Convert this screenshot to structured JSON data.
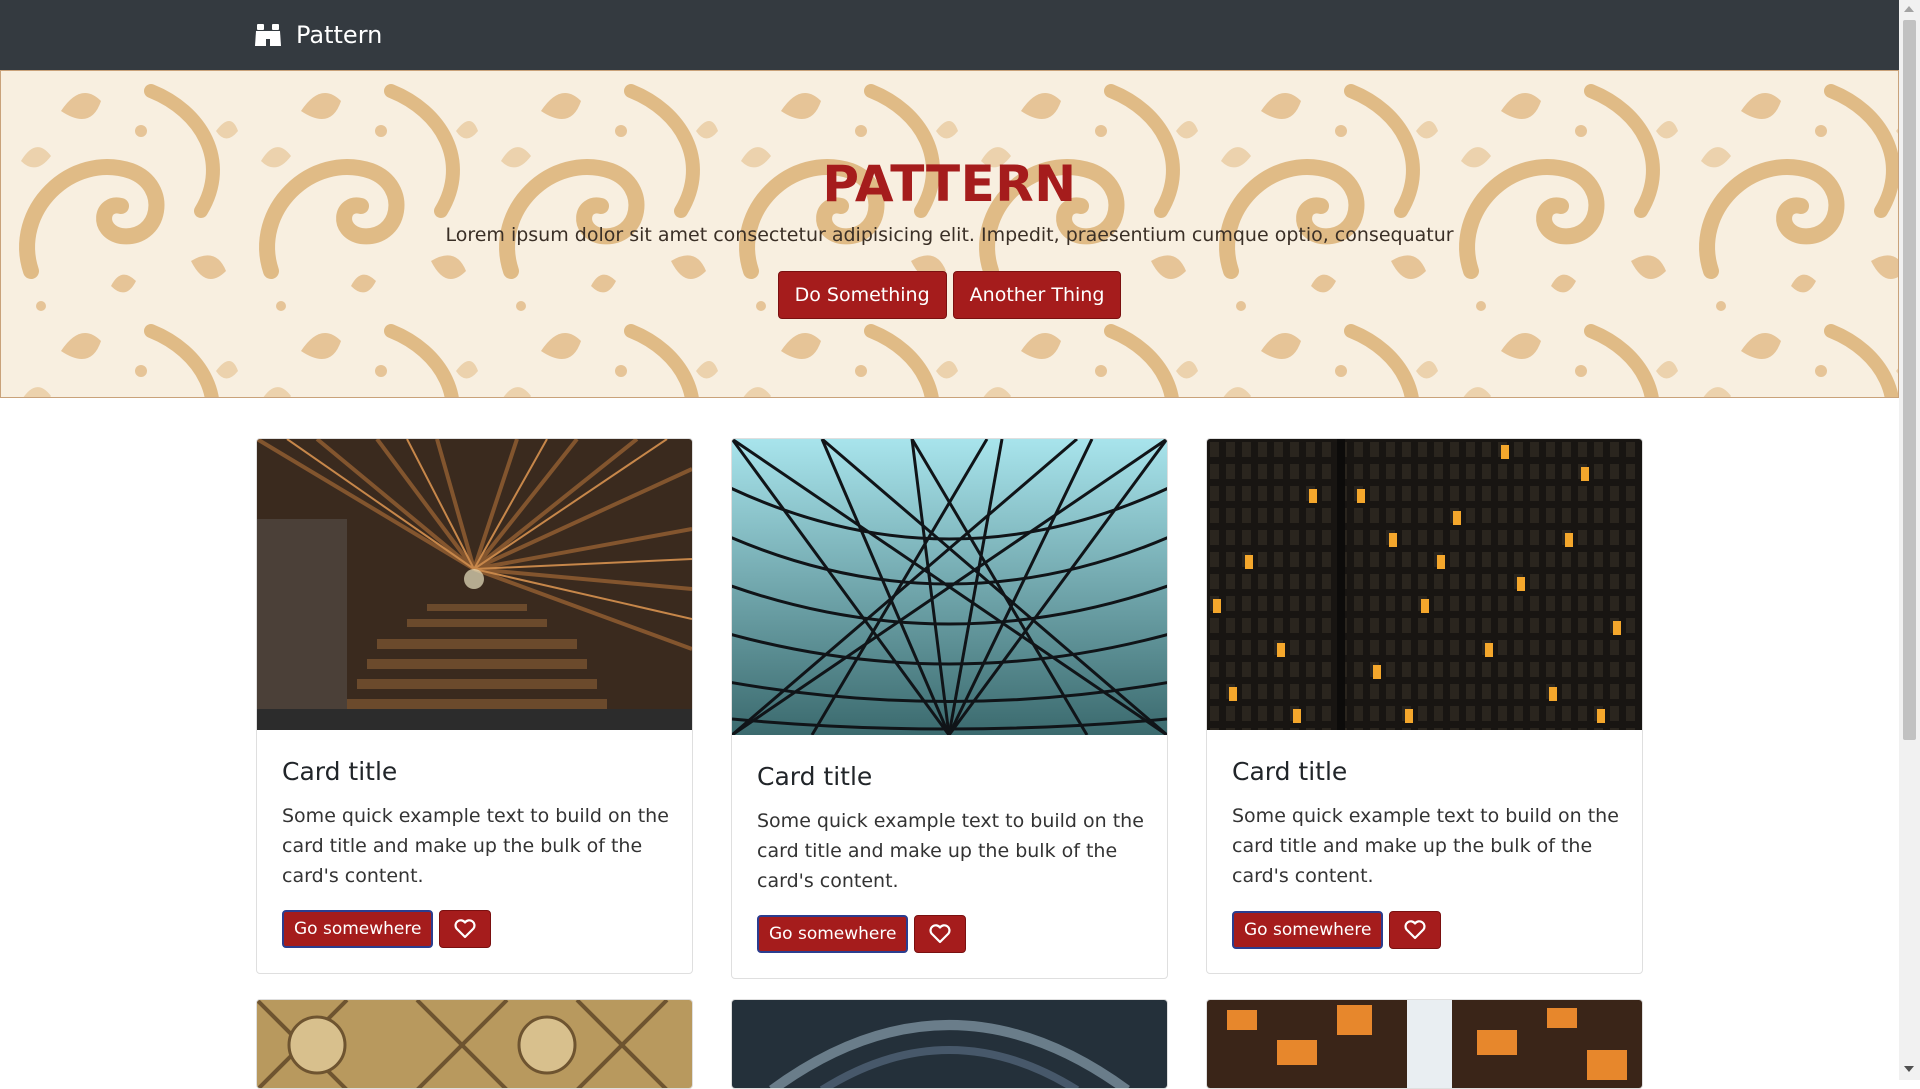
{
  "navbar": {
    "brand": "Pattern",
    "brand_icon": "binoculars-icon"
  },
  "hero": {
    "title": "PATTERN",
    "subtitle": "Lorem ipsum dolor sit amet consectetur adipisicing elit. Impedit, praesentium cumque optio, consequatur",
    "primary_button": "Do Something",
    "secondary_button": "Another Thing"
  },
  "cards": [
    {
      "title": "Card title",
      "text": "Some quick example text to build on the card title and make up the bulk of the card's content.",
      "button": "Go somewhere",
      "image": "wooden-stairway-interior"
    },
    {
      "title": "Card title",
      "text": "Some quick example text to build on the card title and make up the bulk of the card's content.",
      "button": "Go somewhere",
      "image": "glass-lattice-roof"
    },
    {
      "title": "Card title",
      "text": "Some quick example text to build on the card title and make up the bulk of the card's content.",
      "button": "Go somewhere",
      "image": "skyscraper-night-windows"
    }
  ],
  "colors": {
    "accent": "#a51c1c",
    "navbar": "#343a40",
    "hero_bg": "#f8efe0",
    "hero_pattern": "#e0bb86"
  }
}
